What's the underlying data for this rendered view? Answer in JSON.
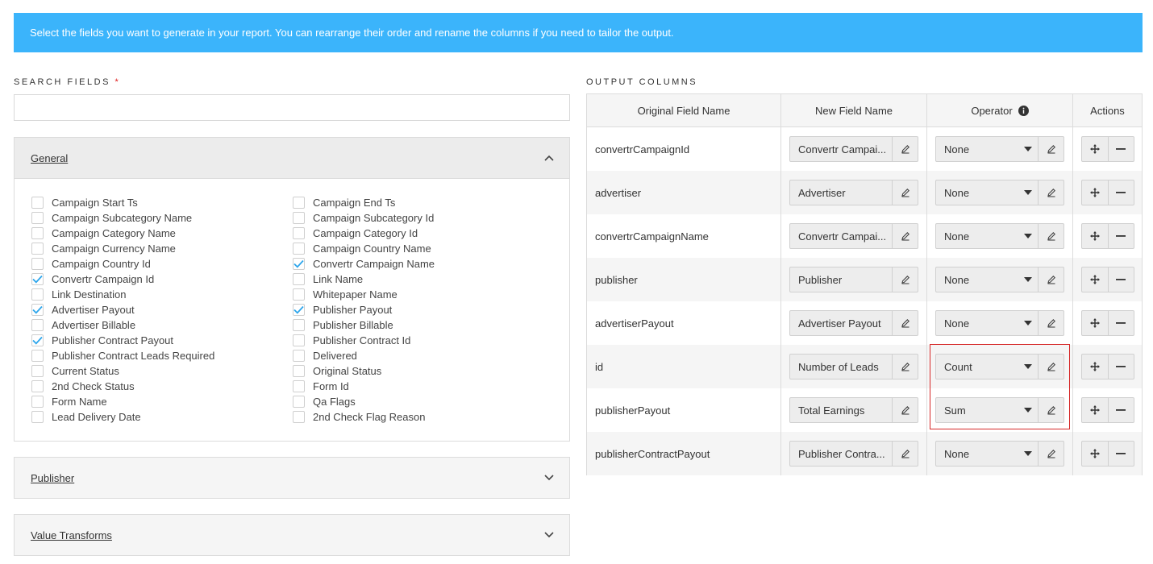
{
  "banner": {
    "text": "Select the fields you want to generate in your report. You can rearrange their order and rename the columns if you need to tailor the output."
  },
  "search": {
    "label": "SEARCH FIELDS",
    "required_mark": "*",
    "value": "",
    "placeholder": ""
  },
  "panels": {
    "general": {
      "title": "General",
      "expanded": true,
      "col1": [
        {
          "label": "Campaign Start Ts",
          "checked": false
        },
        {
          "label": "Campaign Subcategory Name",
          "checked": false
        },
        {
          "label": "Campaign Category Name",
          "checked": false
        },
        {
          "label": "Campaign Currency Name",
          "checked": false
        },
        {
          "label": "Campaign Country Id",
          "checked": false
        },
        {
          "label": "Convertr Campaign Id",
          "checked": true
        },
        {
          "label": "Link Destination",
          "checked": false
        },
        {
          "label": "Advertiser Payout",
          "checked": true
        },
        {
          "label": "Advertiser Billable",
          "checked": false
        },
        {
          "label": "Publisher Contract Payout",
          "checked": true
        },
        {
          "label": "Publisher Contract Leads Required",
          "checked": false
        },
        {
          "label": "Current Status",
          "checked": false
        },
        {
          "label": "2nd Check Status",
          "checked": false
        },
        {
          "label": "Form Name",
          "checked": false
        },
        {
          "label": "Lead Delivery Date",
          "checked": false
        }
      ],
      "col2": [
        {
          "label": "Campaign End Ts",
          "checked": false
        },
        {
          "label": "Campaign Subcategory Id",
          "checked": false
        },
        {
          "label": "Campaign Category Id",
          "checked": false
        },
        {
          "label": "Campaign Country Name",
          "checked": false
        },
        {
          "label": "Convertr Campaign Name",
          "checked": true
        },
        {
          "label": "Link Name",
          "checked": false
        },
        {
          "label": "Whitepaper Name",
          "checked": false
        },
        {
          "label": "Publisher Payout",
          "checked": true
        },
        {
          "label": "Publisher Billable",
          "checked": false
        },
        {
          "label": "Publisher Contract Id",
          "checked": false
        },
        {
          "label": "Delivered",
          "checked": false
        },
        {
          "label": "Original Status",
          "checked": false
        },
        {
          "label": "Form Id",
          "checked": false
        },
        {
          "label": "Qa Flags",
          "checked": false
        },
        {
          "label": "2nd Check Flag Reason",
          "checked": false
        }
      ]
    },
    "publisher": {
      "title": "Publisher",
      "expanded": false
    },
    "value_transforms": {
      "title": "Value Transforms",
      "expanded": false
    }
  },
  "output": {
    "label": "OUTPUT COLUMNS",
    "headers": {
      "original": "Original Field Name",
      "new_name": "New Field Name",
      "operator": "Operator",
      "actions": "Actions"
    },
    "rows": [
      {
        "original": "convertrCampaignId",
        "new_name": "Convertr Campai...",
        "operator": "None"
      },
      {
        "original": "advertiser",
        "new_name": "Advertiser",
        "operator": "None"
      },
      {
        "original": "convertrCampaignName",
        "new_name": "Convertr Campai...",
        "operator": "None"
      },
      {
        "original": "publisher",
        "new_name": "Publisher",
        "operator": "None"
      },
      {
        "original": "advertiserPayout",
        "new_name": "Advertiser Payout",
        "operator": "None"
      },
      {
        "original": "id",
        "new_name": "Number of Leads",
        "operator": "Count"
      },
      {
        "original": "publisherPayout",
        "new_name": "Total Earnings",
        "operator": "Sum"
      },
      {
        "original": "publisherContractPayout",
        "new_name": "Publisher Contra...",
        "operator": "None"
      }
    ]
  },
  "colors": {
    "banner_bg": "#3bb4fb",
    "checkbox_check": "#2ea6ec",
    "highlight": "#d62828"
  }
}
